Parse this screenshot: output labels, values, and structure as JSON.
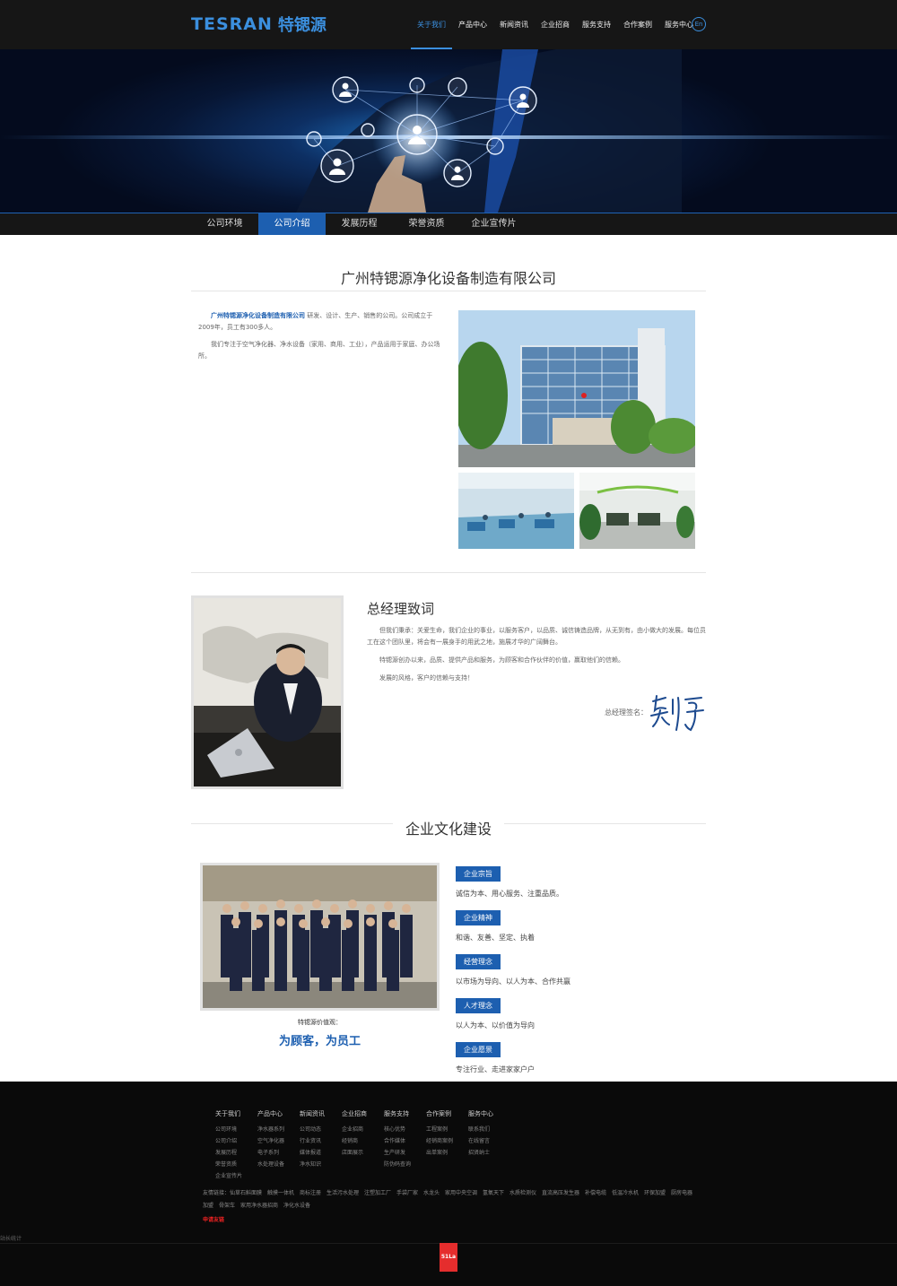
{
  "header": {
    "logo_en": "TESRAN",
    "logo_cn": "特锶源",
    "nav": [
      "关于我们",
      "产品中心",
      "新闻资讯",
      "企业招商",
      "服务支持",
      "合作案例",
      "服务中心"
    ],
    "lang": "En"
  },
  "subnav": [
    "公司环境",
    "公司介绍",
    "发展历程",
    "荣誉资质",
    "企业宣传片"
  ],
  "intro": {
    "title": "广州特锶源净化设备制造有限公司",
    "company": "广州特锶源净化设备制造有限公司",
    "p1_rest": " 研发、设计、生产、销售的公司。公司成立于2009年，员工有300多人。",
    "p2": "我们专注于空气净化器、净水设备（家用、商用、工业），产品运用于家庭、办公场所。"
  },
  "gm": {
    "title": "总经理致词",
    "p1": "但我们秉承：关爱生命，我们企业的事业，以服务客户，以品质、诚信铸造品牌，从无到有，由小做大的发展。每位员工在这个团队里，将会有一展身手的用武之地，施展才华的广阔舞台。",
    "p2": "特锶源创办以来，品质、提供产品和服务，为顾客和合作伙伴的价值，赢取他们的信赖。",
    "p3": "发展的风格，客户的信赖与支持！",
    "sign_label": "总经理签名："
  },
  "culture": {
    "title": "企业文化建设",
    "value_caption": "特锶源价值观：",
    "value_slogan": "为顾客，为员工",
    "items": [
      {
        "tag": "企业宗旨",
        "text": "诚信为本、用心服务、注重品质。"
      },
      {
        "tag": "企业精神",
        "text": "和谐、友善、坚定、执着"
      },
      {
        "tag": "经营理念",
        "text": "以市场为导向、以人为本、合作共赢"
      },
      {
        "tag": "人才理念",
        "text": "以人为本、以价值为导向"
      },
      {
        "tag": "企业愿景",
        "text": "专注行业、走进家家户户"
      }
    ]
  },
  "footer": {
    "columns": [
      {
        "head": "关于我们",
        "links": [
          "公司环境",
          "公司介绍",
          "发展历程",
          "荣誉资质",
          "企业宣传片"
        ]
      },
      {
        "head": "产品中心",
        "links": [
          "净水器系列",
          "空气净化器",
          "电子系列",
          "水处理设备"
        ]
      },
      {
        "head": "新闻资讯",
        "links": [
          "公司动态",
          "行业资讯",
          "媒体报道",
          "净水知识"
        ]
      },
      {
        "head": "企业招商",
        "links": [
          "企业招商",
          "经销商",
          "店面展示"
        ]
      },
      {
        "head": "服务支持",
        "links": [
          "核心优势",
          "合作媒体",
          "生产研发",
          "防伪码查询"
        ]
      },
      {
        "head": "合作案例",
        "links": [
          "工程案例",
          "经销商案例",
          "出单案例"
        ]
      },
      {
        "head": "服务中心",
        "links": [
          "联系我们",
          "在线留言",
          "招贤纳士"
        ]
      }
    ],
    "friends": "友情链接：仙草石斛面膜　触摸一体机　商标注册　生活污水处理　注塑加工厂　手袋厂家　水龙头　家用中央空调　氢氧天下　水质检测仪　直流高压发生器　补偿电缆　低温冷水机　环保加盟　厨房电器加盟　骨架车　家用净水器招商　净化水设备",
    "red": "申请友链",
    "stat": "站长统计",
    "badge": "51La"
  },
  "colors": {
    "accent": "#1d5fb0",
    "dark": "#161616"
  }
}
